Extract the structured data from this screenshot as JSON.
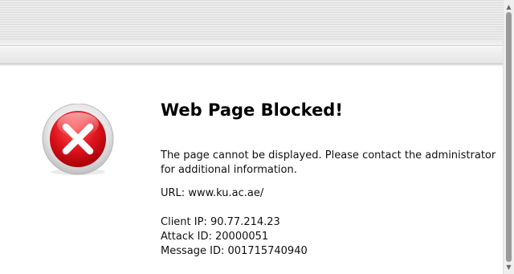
{
  "title": "Web Page Blocked!",
  "message": "The page cannot be displayed. Please contact the administrator for additional information.",
  "url": {
    "label": "URL:",
    "value": "www.ku.ac.ae/"
  },
  "client_ip": {
    "label": "Client IP:",
    "value": "90.77.214.23"
  },
  "attack_id": {
    "label": "Attack ID:",
    "value": "20000051"
  },
  "message_id": {
    "label": "Message ID:",
    "value": "001715740940"
  },
  "icons": {
    "error": "error-x-icon",
    "scroll_up": "chevron-up-icon",
    "scroll_down": "chevron-down-icon"
  },
  "colors": {
    "error_red": "#d9101b",
    "ring_gray": "#c9c9c9"
  }
}
